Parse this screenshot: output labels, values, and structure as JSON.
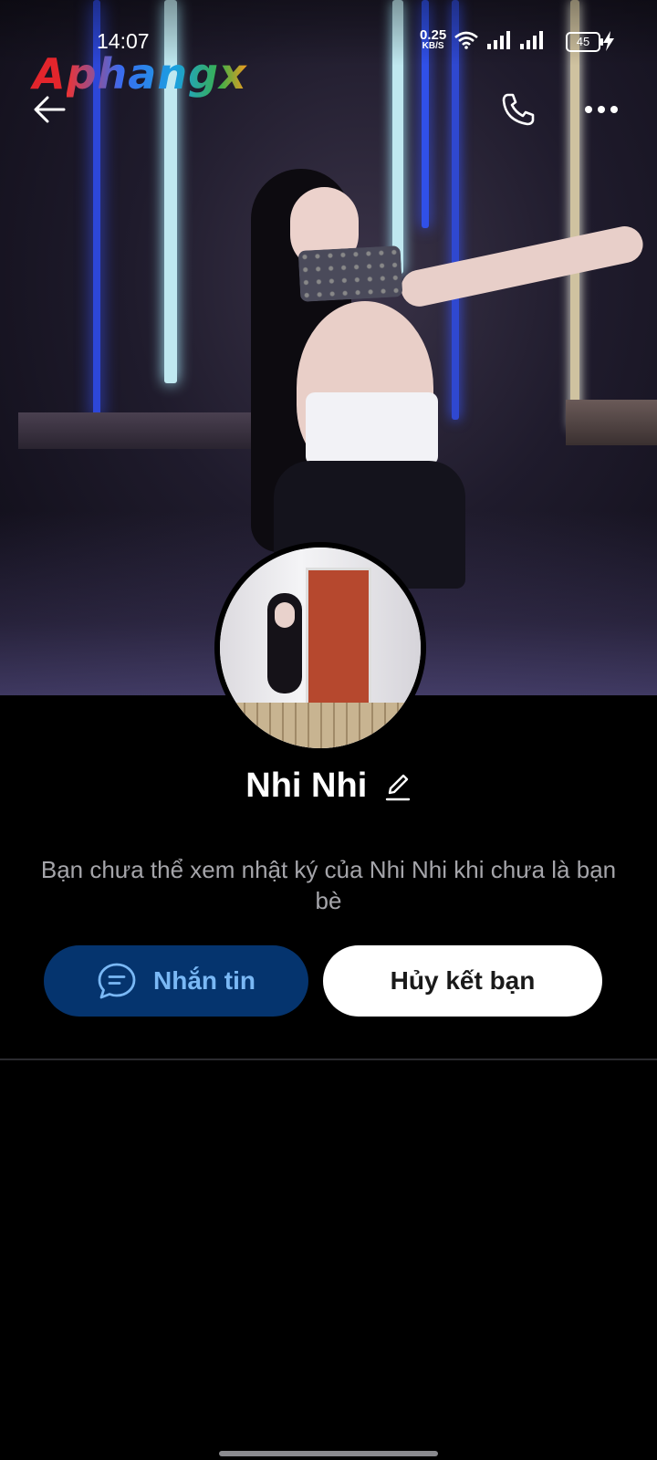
{
  "status_bar": {
    "time": "14:07",
    "net_speed_value": "0.25",
    "net_speed_unit": "KB/S",
    "battery": "45"
  },
  "watermark": {
    "part1": "A",
    "part2": "phangx"
  },
  "header": {
    "back_icon": "arrow-left-icon",
    "call_icon": "phone-icon",
    "more_icon": "more-horizontal-icon"
  },
  "profile": {
    "name": "Nhi Nhi",
    "notice": "Bạn chưa thể xem nhật ký của Nhi Nhi khi chưa là bạn bè"
  },
  "actions": {
    "message_label": "Nhắn tin",
    "message_icon": "chat-bubble-icon",
    "unfriend_label": "Hủy kết bạn"
  },
  "colors": {
    "message_button_bg": "#05346e",
    "message_button_text": "#7ab8f5",
    "notice_text": "#a5a5aa"
  }
}
